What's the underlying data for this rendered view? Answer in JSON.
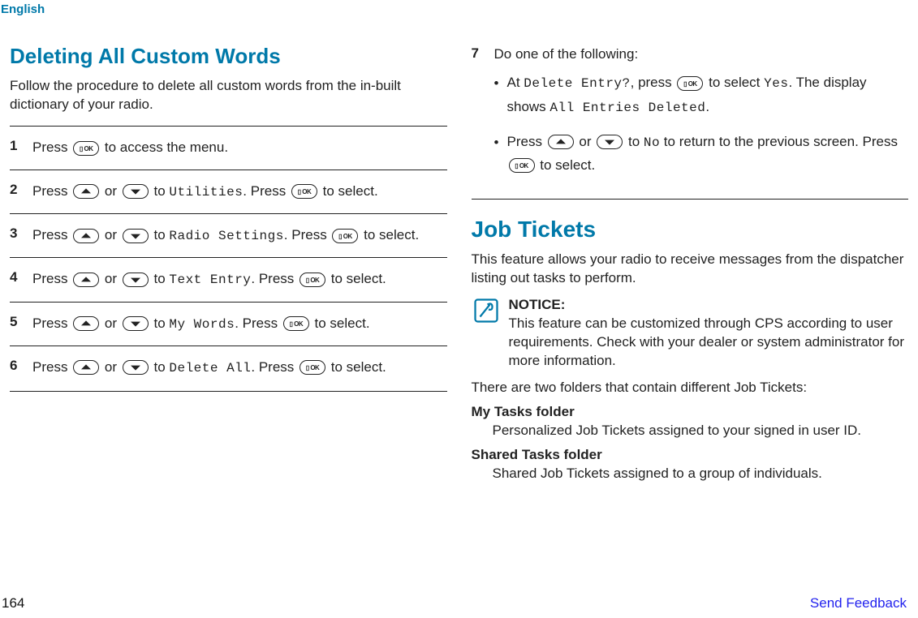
{
  "header": {
    "language": "English"
  },
  "left": {
    "title": "Deleting All Custom Words",
    "intro": "Follow the procedure to delete all custom words from the in-built dictionary of your radio.",
    "steps": [
      {
        "num": "1",
        "p1": "Press ",
        "p2": " to access the menu."
      },
      {
        "num": "2",
        "p1": "Press ",
        "p2": " or ",
        "p3": " to ",
        "code": "Utilities",
        "p4": ". Press ",
        "p5": " to select."
      },
      {
        "num": "3",
        "p1": "Press ",
        "p2": " or ",
        "p3": " to ",
        "code": "Radio Settings",
        "p4": ". Press ",
        "p5": " to select."
      },
      {
        "num": "4",
        "p1": "Press ",
        "p2": " or ",
        "p3": " to ",
        "code": "Text Entry",
        "p4": ". Press ",
        "p5": " to select."
      },
      {
        "num": "5",
        "p1": "Press ",
        "p2": " or ",
        "p3": " to ",
        "code": "My Words",
        "p4": ". Press ",
        "p5": " to select."
      },
      {
        "num": "6",
        "p1": "Press ",
        "p2": " or ",
        "p3": " to ",
        "code": "Delete All",
        "p4": ". Press ",
        "p5": " to select."
      }
    ]
  },
  "right": {
    "step7": {
      "num": "7",
      "lead": "Do one of the following:",
      "bullet1": {
        "p1": "At ",
        "code1": "Delete Entry?",
        "p2": ", press ",
        "p3": " to select ",
        "code2": "Yes",
        "p4": ". The display shows ",
        "code3": "All Entries Deleted",
        "p5": "."
      },
      "bullet2": {
        "p1": "Press ",
        "p2": " or ",
        "p3": " to ",
        "code1": "No",
        "p4": " to return to the previous screen. Press ",
        "p5": " to select."
      }
    },
    "title2": "Job Tickets",
    "intro2": "This feature allows your radio to receive messages from the dispatcher listing out tasks to perform.",
    "notice": {
      "label": "NOTICE:",
      "body": "This feature can be customized through CPS according to user requirements. Check with your dealer or system administrator for more information."
    },
    "folders_intro": "There are two folders that contain different Job Tickets:",
    "folders": [
      {
        "term": "My Tasks folder",
        "def": "Personalized Job Tickets assigned to your signed in user ID."
      },
      {
        "term": "Shared Tasks folder",
        "def": "Shared Job Tickets assigned to a group of individuals."
      }
    ]
  },
  "footer": {
    "page": "164",
    "feedback": "Send Feedback"
  }
}
